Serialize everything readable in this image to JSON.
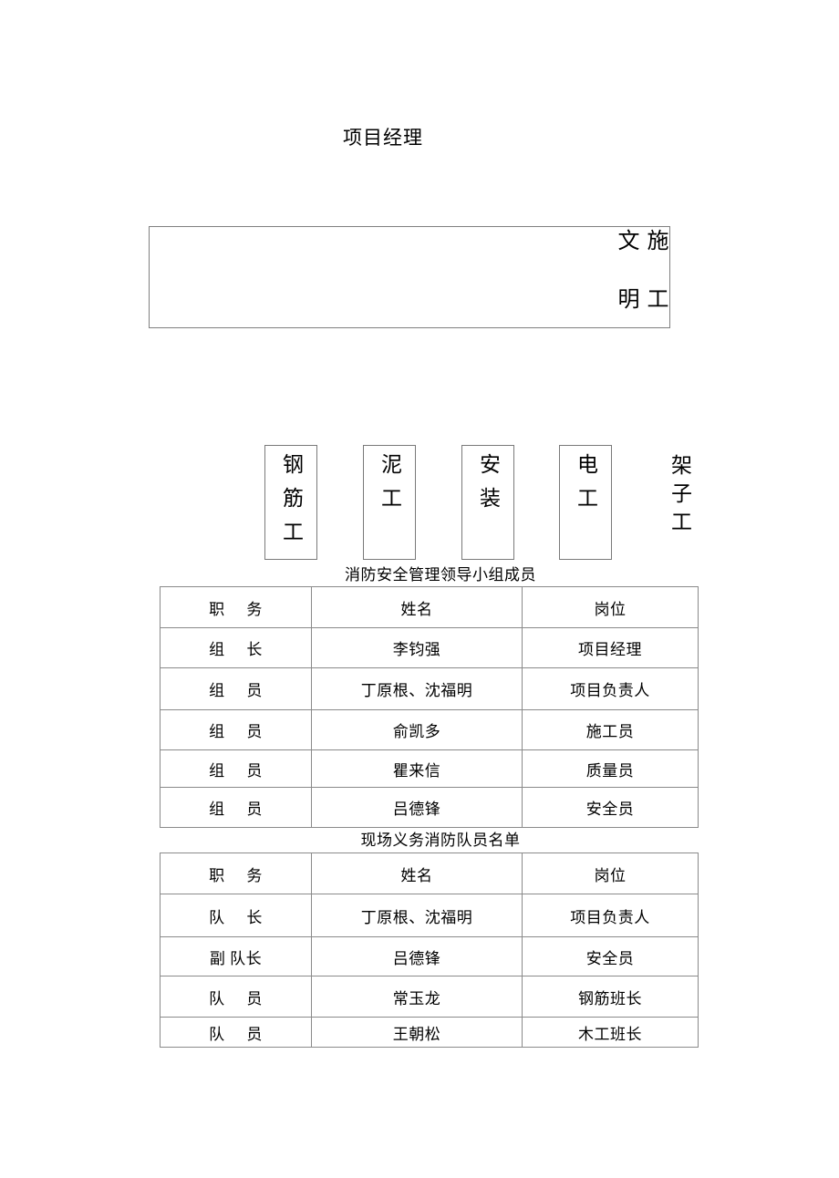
{
  "page": {
    "title": "项目经理"
  },
  "banner": {
    "columns": [
      "施工",
      "文明"
    ]
  },
  "trades": {
    "items": [
      {
        "label": "钢筋工",
        "boxed": true
      },
      {
        "label": "泥工",
        "boxed": true
      },
      {
        "label": "安装",
        "boxed": true
      },
      {
        "label": "电工",
        "boxed": true
      },
      {
        "label": "架子工",
        "boxed": false
      }
    ]
  },
  "tables": [
    {
      "caption": "消防安全管理领导小组成员",
      "headers": [
        "职     务",
        "姓名",
        "岗位"
      ],
      "rows": [
        [
          "组     长",
          "李钧强",
          "项目经理"
        ],
        [
          "组     员",
          "丁原根、沈福明",
          "项目负责人"
        ],
        [
          "组     员",
          "俞凯多",
          "施工员"
        ],
        [
          "组     员",
          "瞿来信",
          "质量员"
        ],
        [
          "组     员",
          "吕德锋",
          "安全员"
        ]
      ]
    },
    {
      "caption": "现场义务消防队员名单",
      "headers": [
        "职     务",
        "姓名",
        "岗位"
      ],
      "rows": [
        [
          "队     长",
          "丁原根、沈福明",
          "项目负责人"
        ],
        [
          "副 队长",
          "吕德锋",
          "安全员"
        ],
        [
          "队     员",
          "常玉龙",
          "钢筋班长"
        ],
        [
          "队     员",
          "王朝松",
          "木工班长"
        ]
      ]
    }
  ]
}
